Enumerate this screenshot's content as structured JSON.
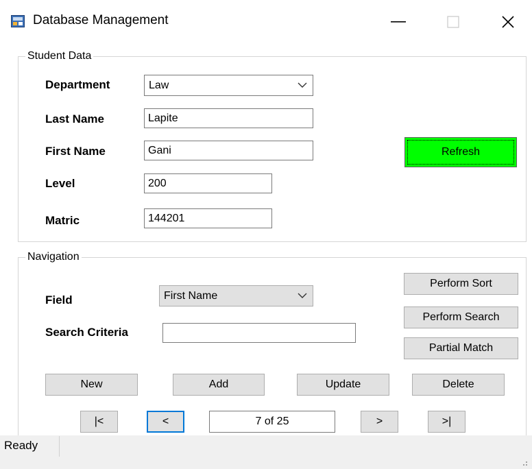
{
  "window": {
    "title": "Database Management",
    "minimize": "—",
    "close": "✕"
  },
  "student": {
    "legend": "Student Data",
    "department": {
      "label": "Department",
      "value": "Law"
    },
    "last_name": {
      "label": "Last Name",
      "value": "Lapite"
    },
    "first_name": {
      "label": "First Name",
      "value": "Gani"
    },
    "level": {
      "label": "Level",
      "value": "200"
    },
    "matric": {
      "label": "Matric",
      "value": "144201"
    },
    "refresh": "Refresh"
  },
  "navigation": {
    "legend": "Navigation",
    "field": {
      "label": "Field",
      "value": "First Name"
    },
    "search": {
      "label": "Search Criteria",
      "value": ""
    },
    "perform_sort": "Perform Sort",
    "perform_search": "Perform Search",
    "partial_match": "Partial Match",
    "new": "New",
    "add": "Add",
    "update": "Update",
    "delete": "Delete",
    "first": "|<",
    "prev": "<",
    "position": "7 of 25",
    "next": ">",
    "last": ">|"
  },
  "status": {
    "text": "Ready"
  },
  "colors": {
    "refresh_bg": "#00ff00",
    "focus": "#0078d7",
    "button_bg": "#e1e1e1"
  }
}
